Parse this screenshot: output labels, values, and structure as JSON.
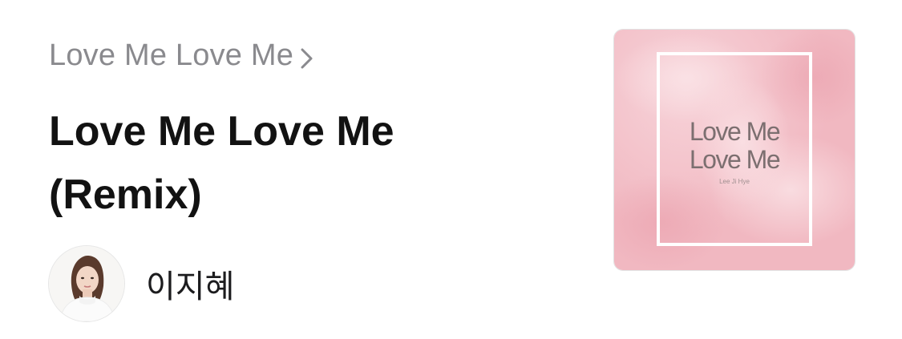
{
  "header": {
    "breadcrumb": "Love Me Love Me",
    "breadcrumb_icon": "chevron-right-icon"
  },
  "track": {
    "title": "Love Me Love Me (Remix)"
  },
  "artist": {
    "name": "이지혜",
    "avatar_icon": "artist-avatar"
  },
  "album_cover": {
    "line1": "Love Me",
    "line2": "Love Me",
    "subtitle": "Lee Ji Hye",
    "background_color": "#f1b9c2",
    "frame_color": "#ffffff"
  }
}
